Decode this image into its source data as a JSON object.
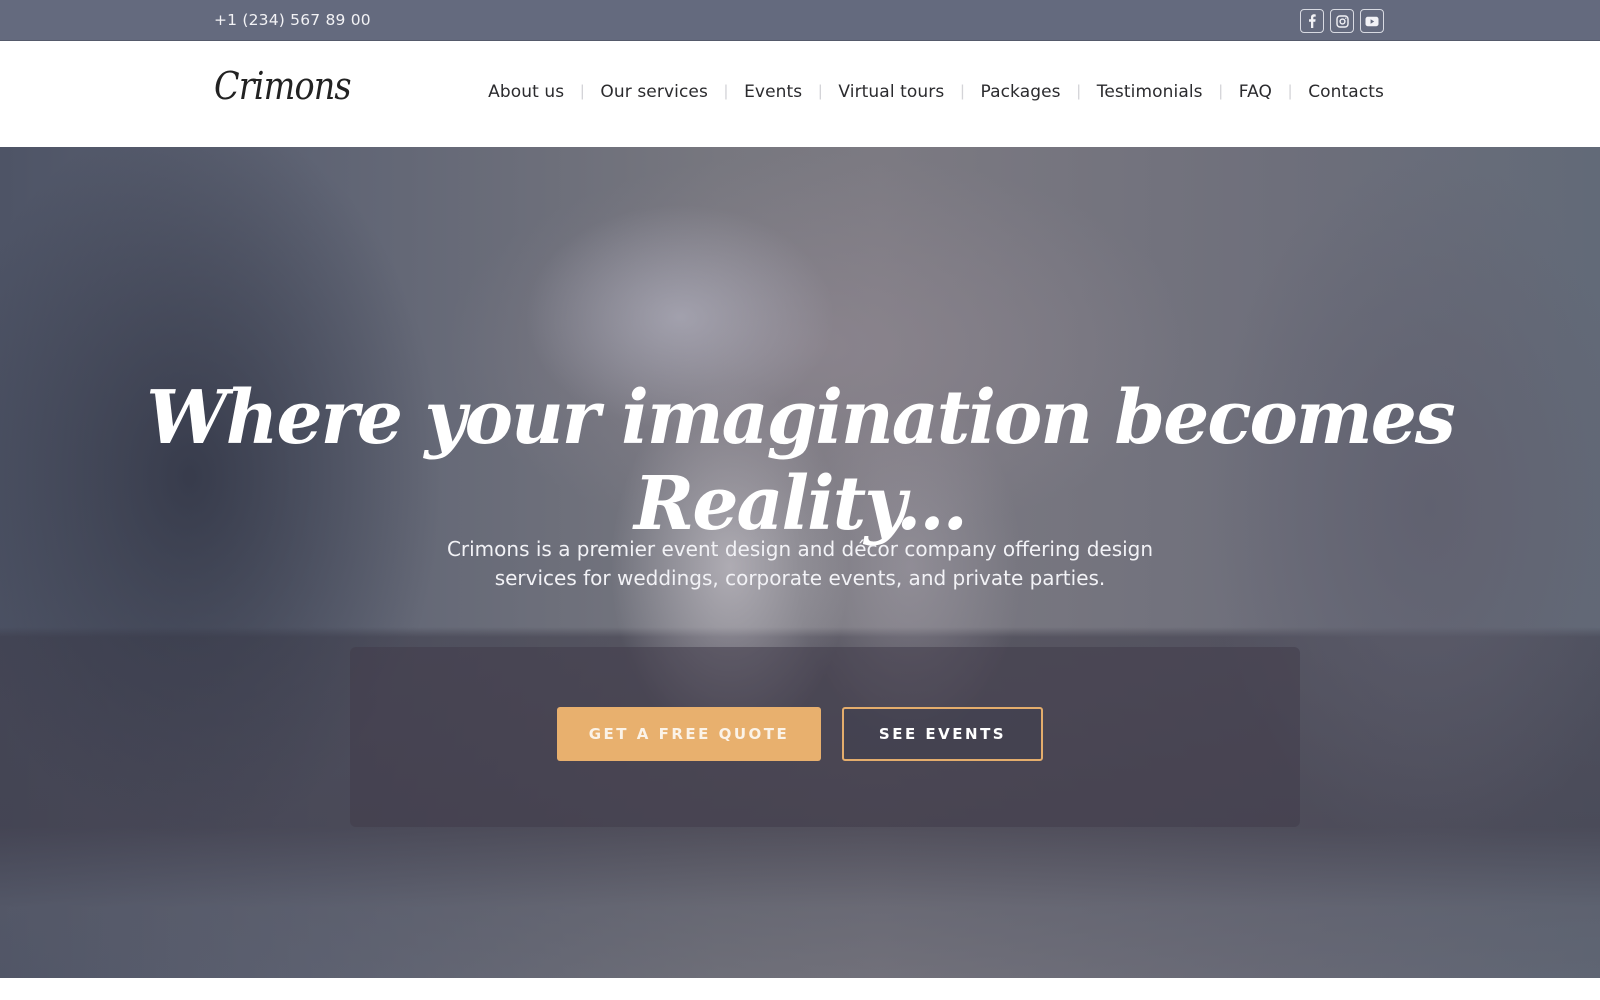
{
  "topbar": {
    "phone": "+1 (234) 567 89 00",
    "socials": [
      {
        "name": "facebook",
        "icon": "facebook-icon"
      },
      {
        "name": "instagram",
        "icon": "instagram-icon"
      },
      {
        "name": "youtube",
        "icon": "youtube-icon"
      }
    ]
  },
  "header": {
    "logo": "Crimons",
    "nav": [
      {
        "label": "About us"
      },
      {
        "label": "Our services"
      },
      {
        "label": "Events"
      },
      {
        "label": "Virtual tours"
      },
      {
        "label": "Packages"
      },
      {
        "label": "Testimonials"
      },
      {
        "label": "FAQ"
      },
      {
        "label": "Contacts"
      }
    ],
    "separator": "|"
  },
  "hero": {
    "title": "Where your imagination becomes Reality...",
    "description": "Crimons is a premier event design and décor company offering design services for weddings, corporate events, and private parties.",
    "primary_button": "GET A FREE QUOTE",
    "secondary_button": "SEE EVENTS"
  },
  "colors": {
    "topbar_bg": "#646a7e",
    "accent": "#e8b06e",
    "text_dark": "#2b2b2e",
    "white": "#ffffff"
  }
}
